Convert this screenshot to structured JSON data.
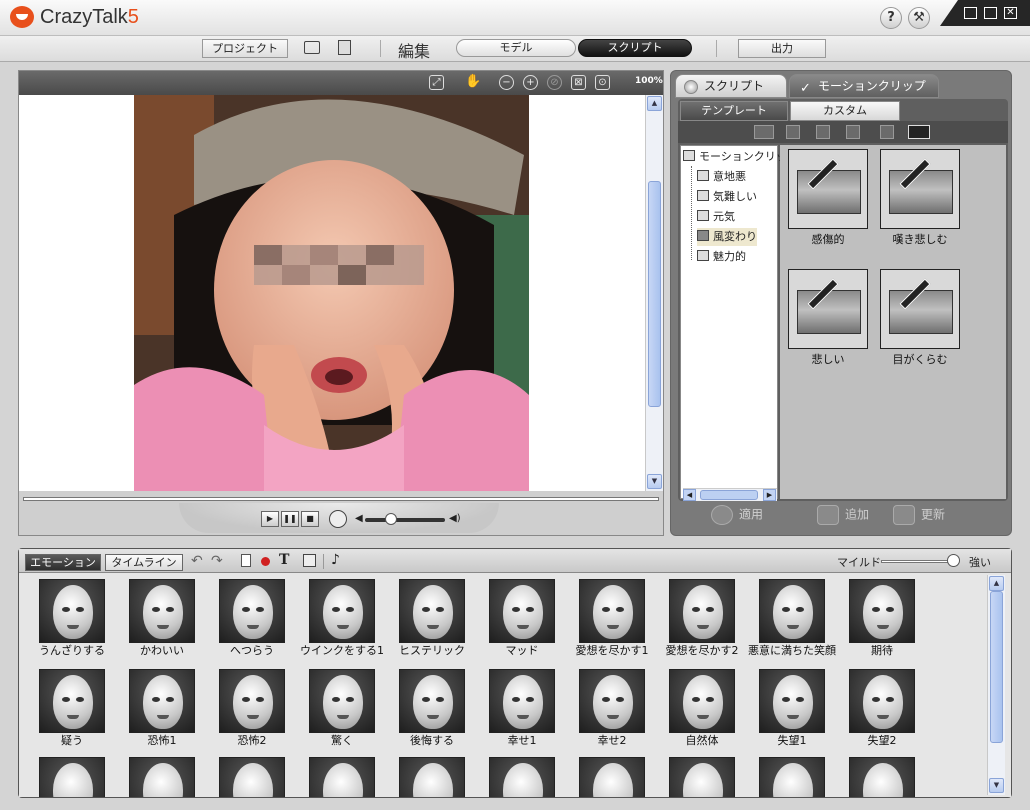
{
  "app": {
    "name": "CrazyTalk",
    "version": "5"
  },
  "title_controls": {
    "help": "?",
    "tools": "⚒"
  },
  "menu": {
    "project": "プロジェクト",
    "edit": "編集",
    "model": "モデル",
    "script": "スクリプト",
    "output": "出力"
  },
  "preview": {
    "zoom": "100%"
  },
  "right_panel": {
    "tab_script": "スクリプト",
    "tab_motion": "モーションクリップ",
    "tab_template": "テンプレート",
    "tab_custom": "カスタム",
    "tree_root": "モーションクリップ",
    "tree_items": [
      "意地悪",
      "気難しい",
      "元気",
      "風変わり",
      "魅力的"
    ],
    "clips": [
      "感傷的",
      "嘆き悲しむ",
      "悲しい",
      "目がくらむ"
    ],
    "actions": {
      "apply": "適用",
      "add": "追加",
      "update": "更新"
    }
  },
  "bottom_panel": {
    "tab_emotion": "エモーション",
    "tab_timeline": "タイムライン",
    "mild": "マイルド",
    "strong": "強い",
    "intensity": 0.92,
    "emotions_row1": [
      "うんざりする",
      "かわいい",
      "へつらう",
      "ウインクをする1",
      "ヒステリック",
      "マッド",
      "愛想を尽かす1",
      "愛想を尽かす2",
      "悪意に満ちた笑顔",
      "期待"
    ],
    "emotions_row2": [
      "疑う",
      "恐怖1",
      "恐怖2",
      "驚く",
      "後悔する",
      "幸せ1",
      "幸せ2",
      "自然体",
      "失望1",
      "失望2"
    ]
  },
  "colors": {
    "accent": "#e8501c",
    "panel_dark": "#5f5f5f",
    "scroll": "#a9c2ee"
  },
  "icons": [
    "logo-icon",
    "help-icon",
    "tools-icon",
    "minimize-icon",
    "maximize-icon",
    "close-icon",
    "folder-open-icon",
    "save-icon",
    "fit-icon",
    "hand-icon",
    "zoom-out-icon",
    "zoom-in-icon",
    "reset-icon",
    "frame-icon",
    "center-icon",
    "play-icon",
    "pause-icon",
    "stop-icon",
    "loop-icon",
    "volume-icon"
  ]
}
